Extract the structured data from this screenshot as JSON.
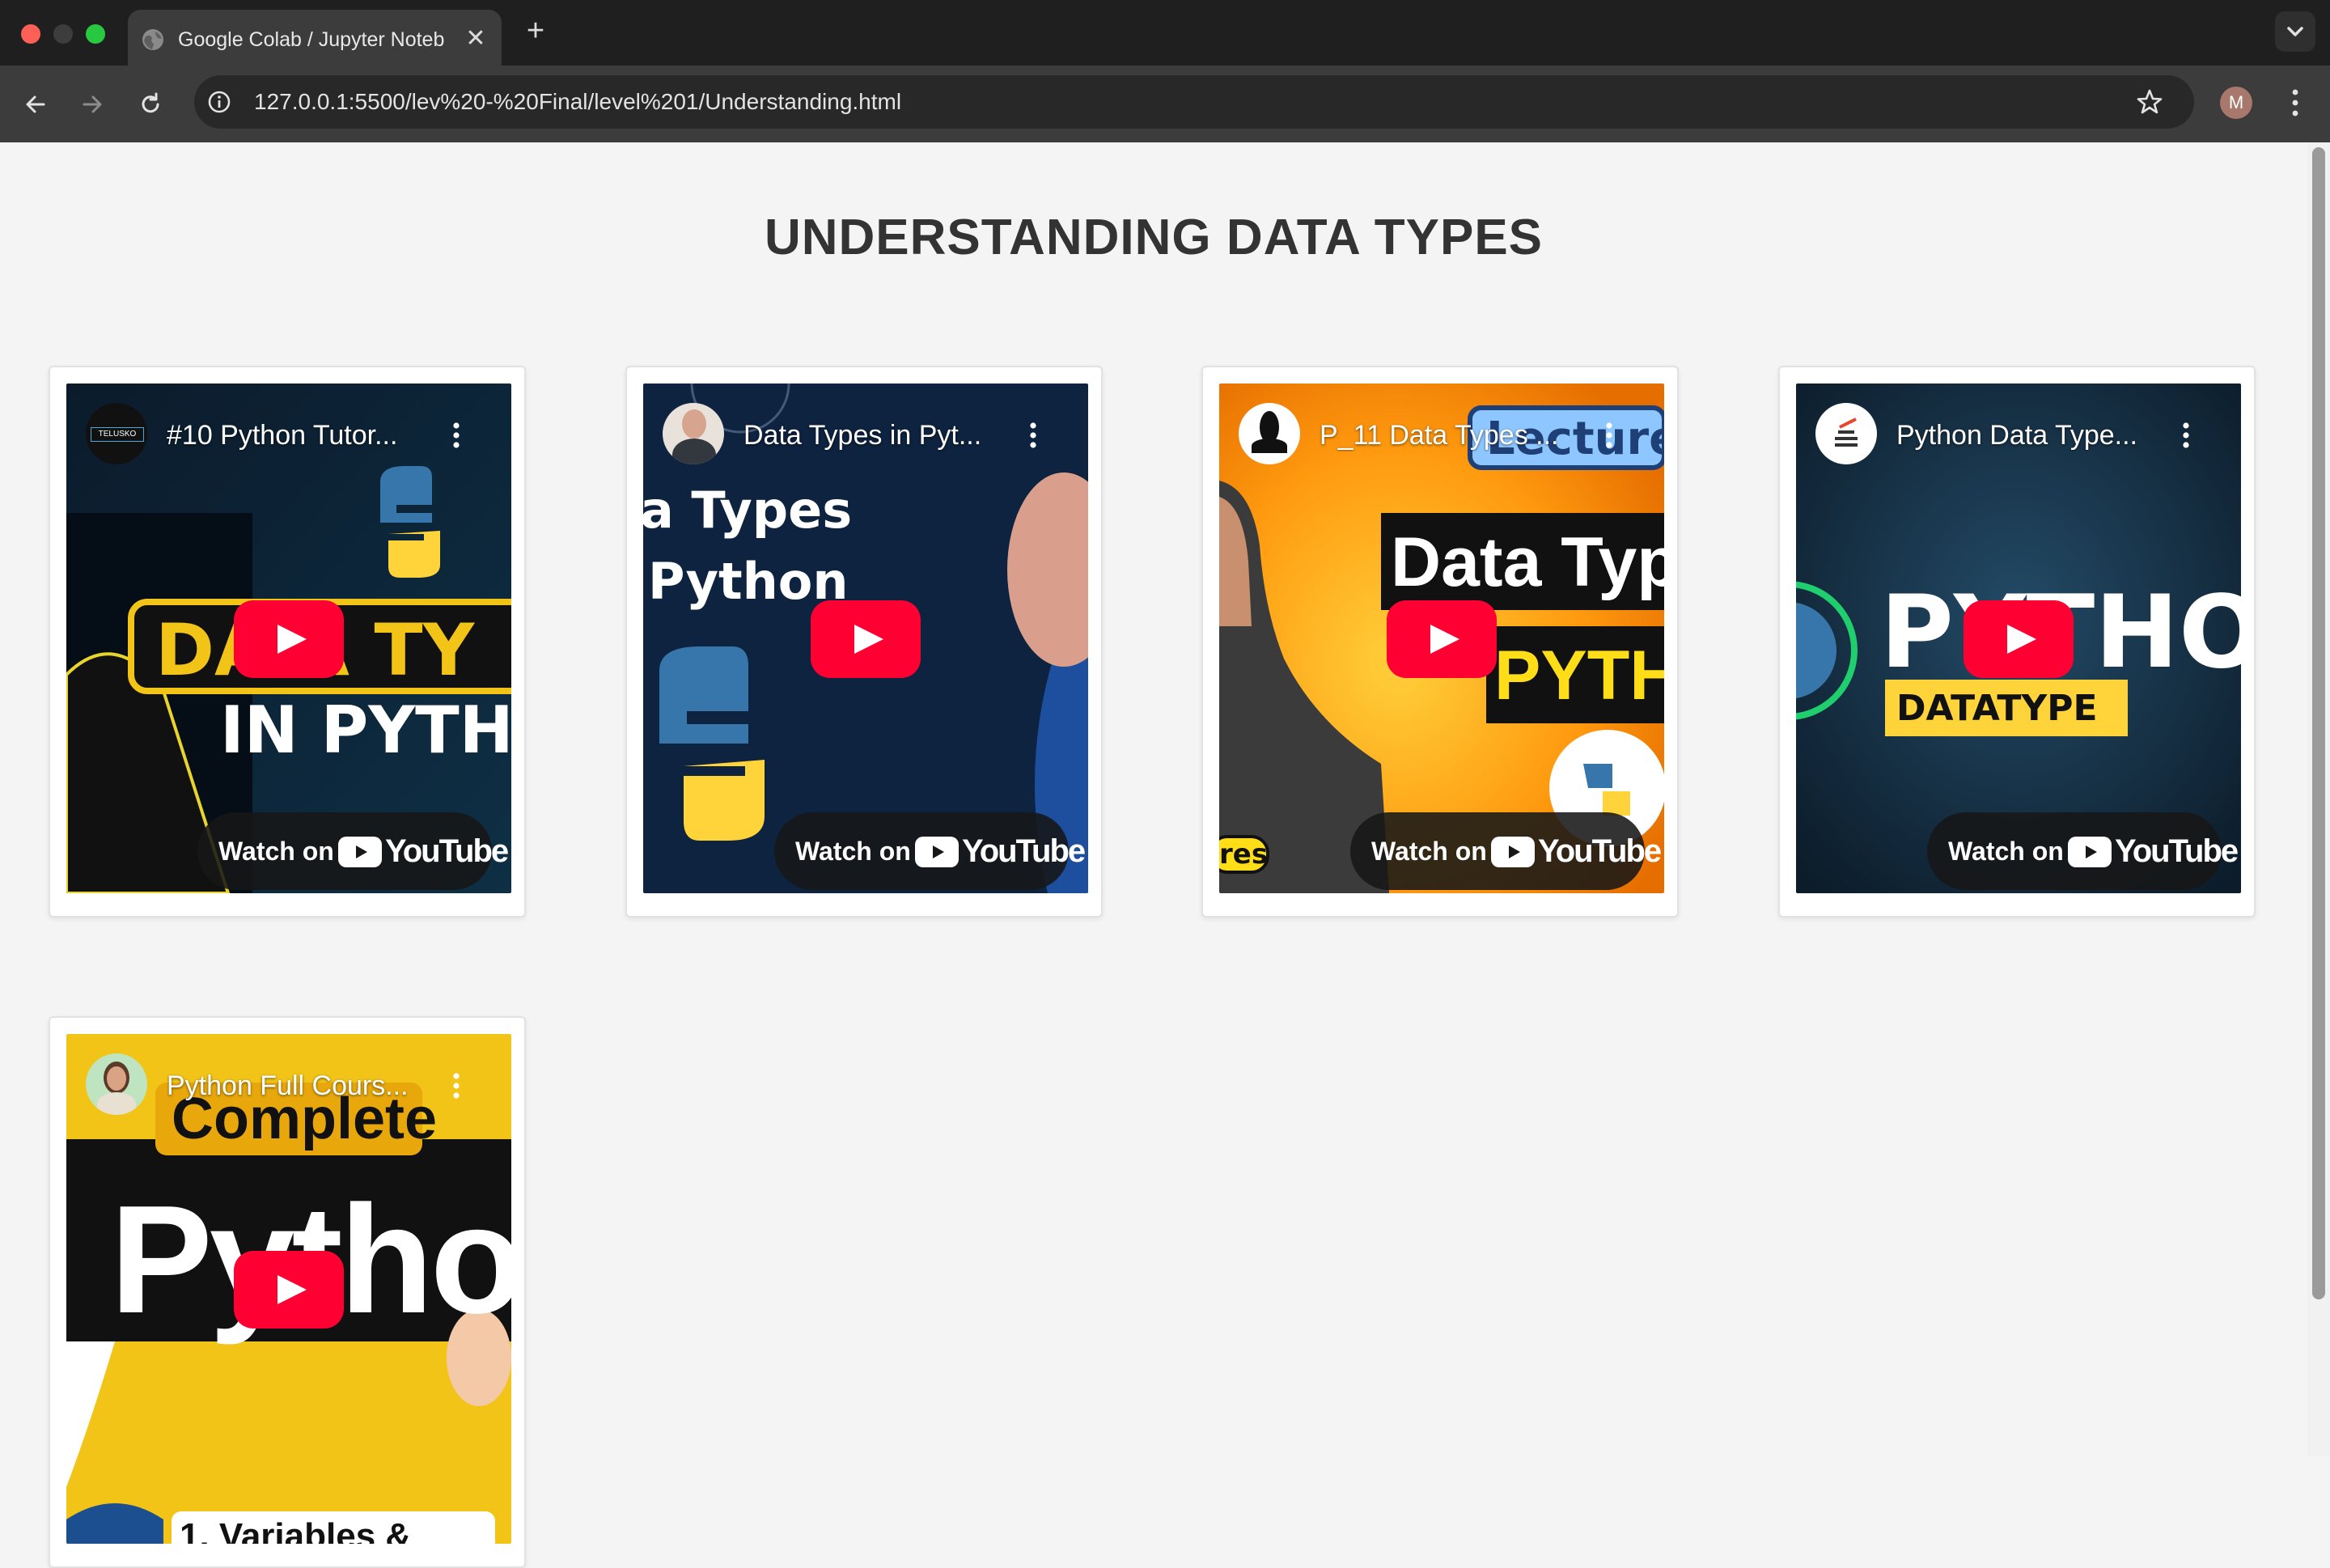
{
  "browser": {
    "tab_title": "Google Colab / Jupyter Noteb",
    "tab_close": "✕",
    "new_tab": "+",
    "url": "127.0.0.1:5500/lev%20-%20Final/level%201/Understanding.html",
    "avatar_letter": "M"
  },
  "page": {
    "title": "UNDERSTANDING DATA TYPES"
  },
  "videos": [
    {
      "title": "#10 Python Tutor...",
      "channel_badge": "TELUSKO",
      "thumb_line1": "DA  A TY",
      "thumb_line2": "IN PYTH",
      "watch_on": "Watch on",
      "brand": "YouTube"
    },
    {
      "title": "Data Types in Pyt...",
      "thumb_line1": "a Types",
      "thumb_line2": "Python",
      "watch_on": "Watch on",
      "brand": "YouTube"
    },
    {
      "title": "P_11 Data Types ...",
      "thumb_line1": "Lecture",
      "thumb_line2": "Data Typ",
      "thumb_line3": "PYTHO",
      "thumb_line4": "res",
      "watch_on": "Watch on",
      "brand": "YouTube"
    },
    {
      "title": "Python Data Type...",
      "thumb_line1": "PYTHO",
      "thumb_line2": "DATATYPE",
      "watch_on": "Watch on",
      "brand": "YouTube"
    },
    {
      "title": "Python Full Cours...",
      "thumb_line1": "Complete",
      "thumb_line2": "Python",
      "thumb_line3": "1. Variables &"
    }
  ],
  "colors": {
    "youtube_red": "#ff0033",
    "page_bg": "#f4f4f4",
    "title_text": "#333333"
  }
}
